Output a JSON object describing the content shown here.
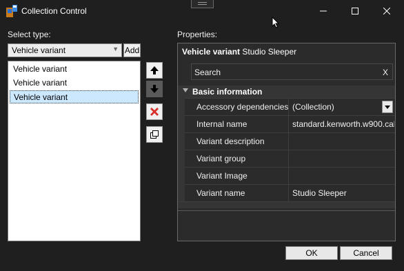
{
  "window": {
    "title": "Collection Control",
    "controls": {
      "minimize": "—",
      "maximize": "☐",
      "close": "✕"
    }
  },
  "left": {
    "select_type_label": "Select type:",
    "type_value": "Vehicle variant",
    "add_label": "Add",
    "items": [
      "Vehicle variant",
      "Vehicle variant",
      "Vehicle variant"
    ],
    "selected_index": 2
  },
  "properties": {
    "label": "Properties:",
    "header_type": "Vehicle variant",
    "header_name": "Studio Sleeper",
    "search_placeholder": "Search",
    "search_clear": "X",
    "category": "Basic information",
    "rows": [
      {
        "name": "Accessory dependencies",
        "value": "(Collection)"
      },
      {
        "name": "Internal name",
        "value": "standard.kenworth.w900.cal"
      },
      {
        "name": "Variant description",
        "value": ""
      },
      {
        "name": "Variant group",
        "value": ""
      },
      {
        "name": "Variant Image",
        "value": ""
      },
      {
        "name": "Variant name",
        "value": "Studio Sleeper"
      }
    ]
  },
  "footer": {
    "ok": "OK",
    "cancel": "Cancel"
  },
  "icons": {
    "move_up": "arrow-up-icon",
    "move_down": "arrow-down-icon",
    "remove": "red-x-icon",
    "clone": "copy-icon"
  },
  "colors": {
    "selection": "#cce8ff",
    "remove_red": "#d9302b"
  }
}
